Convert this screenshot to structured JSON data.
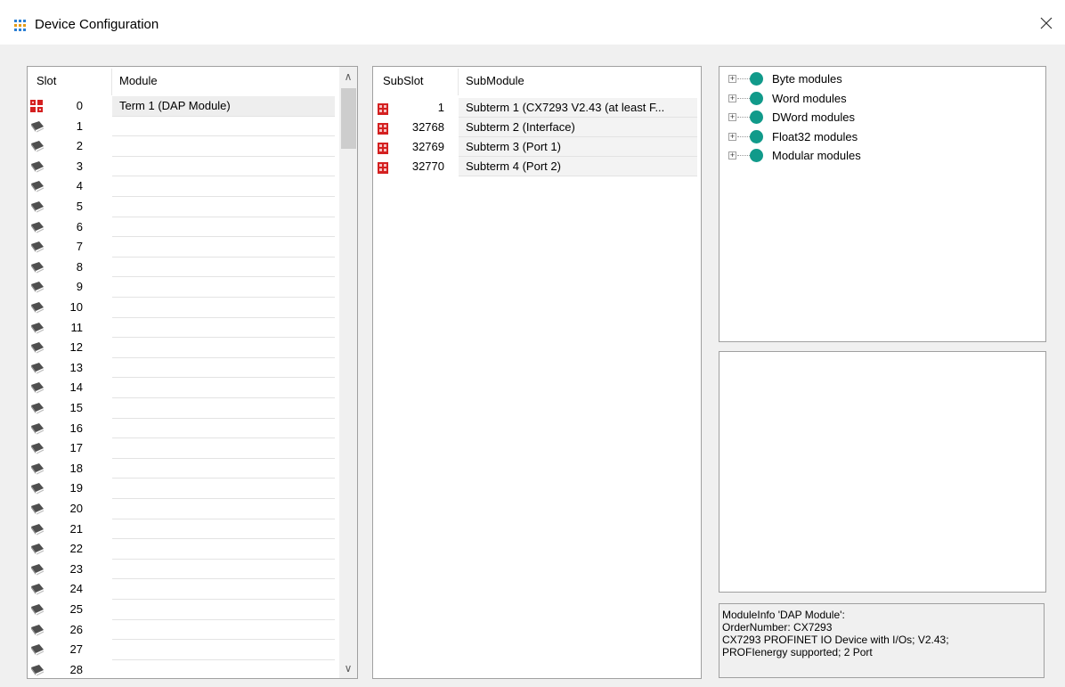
{
  "window": {
    "title": "Device Configuration",
    "close_symbol": "✕",
    "icon": "network-modules-icon"
  },
  "slots": {
    "headers": {
      "slot": "Slot",
      "module": "Module"
    },
    "rows": [
      {
        "slot": "0",
        "module": "Term 1 (DAP Module)",
        "icon": "dap-module-icon"
      },
      {
        "slot": "1",
        "module": "",
        "icon": "empty-slot-icon"
      },
      {
        "slot": "2",
        "module": "",
        "icon": "empty-slot-icon"
      },
      {
        "slot": "3",
        "module": "",
        "icon": "empty-slot-icon"
      },
      {
        "slot": "4",
        "module": "",
        "icon": "empty-slot-icon"
      },
      {
        "slot": "5",
        "module": "",
        "icon": "empty-slot-icon"
      },
      {
        "slot": "6",
        "module": "",
        "icon": "empty-slot-icon"
      },
      {
        "slot": "7",
        "module": "",
        "icon": "empty-slot-icon"
      },
      {
        "slot": "8",
        "module": "",
        "icon": "empty-slot-icon"
      },
      {
        "slot": "9",
        "module": "",
        "icon": "empty-slot-icon"
      },
      {
        "slot": "10",
        "module": "",
        "icon": "empty-slot-icon"
      },
      {
        "slot": "11",
        "module": "",
        "icon": "empty-slot-icon"
      },
      {
        "slot": "12",
        "module": "",
        "icon": "empty-slot-icon"
      },
      {
        "slot": "13",
        "module": "",
        "icon": "empty-slot-icon"
      },
      {
        "slot": "14",
        "module": "",
        "icon": "empty-slot-icon"
      },
      {
        "slot": "15",
        "module": "",
        "icon": "empty-slot-icon"
      },
      {
        "slot": "16",
        "module": "",
        "icon": "empty-slot-icon"
      },
      {
        "slot": "17",
        "module": "",
        "icon": "empty-slot-icon"
      },
      {
        "slot": "18",
        "module": "",
        "icon": "empty-slot-icon"
      },
      {
        "slot": "19",
        "module": "",
        "icon": "empty-slot-icon"
      },
      {
        "slot": "20",
        "module": "",
        "icon": "empty-slot-icon"
      },
      {
        "slot": "21",
        "module": "",
        "icon": "empty-slot-icon"
      },
      {
        "slot": "22",
        "module": "",
        "icon": "empty-slot-icon"
      },
      {
        "slot": "23",
        "module": "",
        "icon": "empty-slot-icon"
      },
      {
        "slot": "24",
        "module": "",
        "icon": "empty-slot-icon"
      },
      {
        "slot": "25",
        "module": "",
        "icon": "empty-slot-icon"
      },
      {
        "slot": "26",
        "module": "",
        "icon": "empty-slot-icon"
      },
      {
        "slot": "27",
        "module": "",
        "icon": "empty-slot-icon"
      },
      {
        "slot": "28",
        "module": "",
        "icon": "empty-slot-icon"
      }
    ],
    "scroll_up": "∧",
    "scroll_down": "∨"
  },
  "subslots": {
    "headers": {
      "subslot": "SubSlot",
      "submodule": "SubModule"
    },
    "rows": [
      {
        "subslot": "1",
        "submodule": "Subterm 1 (CX7293 V2.43 (at least F...",
        "icon": "submodule-icon"
      },
      {
        "subslot": "32768",
        "submodule": "Subterm 2 (Interface)",
        "icon": "submodule-icon"
      },
      {
        "subslot": "32769",
        "submodule": "Subterm 3 (Port 1)",
        "icon": "submodule-icon"
      },
      {
        "subslot": "32770",
        "submodule": "Subterm 4 (Port 2)",
        "icon": "submodule-icon"
      }
    ]
  },
  "catalog": {
    "items": [
      {
        "label": "Byte modules",
        "expander": "+",
        "icon": "teal-circle-icon"
      },
      {
        "label": "Word modules",
        "expander": "+",
        "icon": "teal-circle-icon"
      },
      {
        "label": "DWord modules",
        "expander": "+",
        "icon": "teal-circle-icon"
      },
      {
        "label": "Float32 modules",
        "expander": "+",
        "icon": "teal-circle-icon"
      },
      {
        "label": "Modular modules",
        "expander": "+",
        "icon": "teal-circle-icon"
      }
    ],
    "circle_color": "#119a8a"
  },
  "module_info": {
    "lines": [
      "ModuleInfo 'DAP Module':",
      "OrderNumber: CX7293",
      "CX7293 PROFINET IO Device with I/Os; V2.43;",
      "PROFIenergy supported; 2 Port"
    ]
  },
  "colors": {
    "dap_red": "#d42020",
    "slot_gray": "#5a5a5a"
  }
}
